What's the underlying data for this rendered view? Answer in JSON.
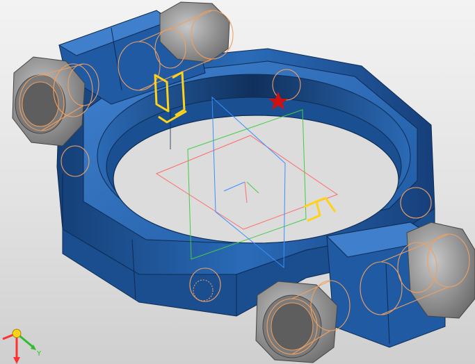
{
  "viewport": {
    "background_top": "#f3f3f3",
    "background_bottom": "#cfcfcf"
  },
  "model": {
    "body_color": "#1f5aa3",
    "body_dark": "#153f77",
    "body_light": "#3f7fcc",
    "nut_color": "#8c8c8c",
    "thread_color": "#f0a060",
    "highlight_color": "#ffd21a",
    "origin_marker_color": "#d01010",
    "plane_colors": {
      "front": "#ff6b6b",
      "top": "#44cc44",
      "right": "#3a8fff"
    }
  },
  "triad": {
    "x_color": "#ff3030",
    "y_color": "#2ebd2e",
    "z_color": "#ff3030",
    "origin_color": "#ffd21a",
    "y_label": "Y"
  }
}
